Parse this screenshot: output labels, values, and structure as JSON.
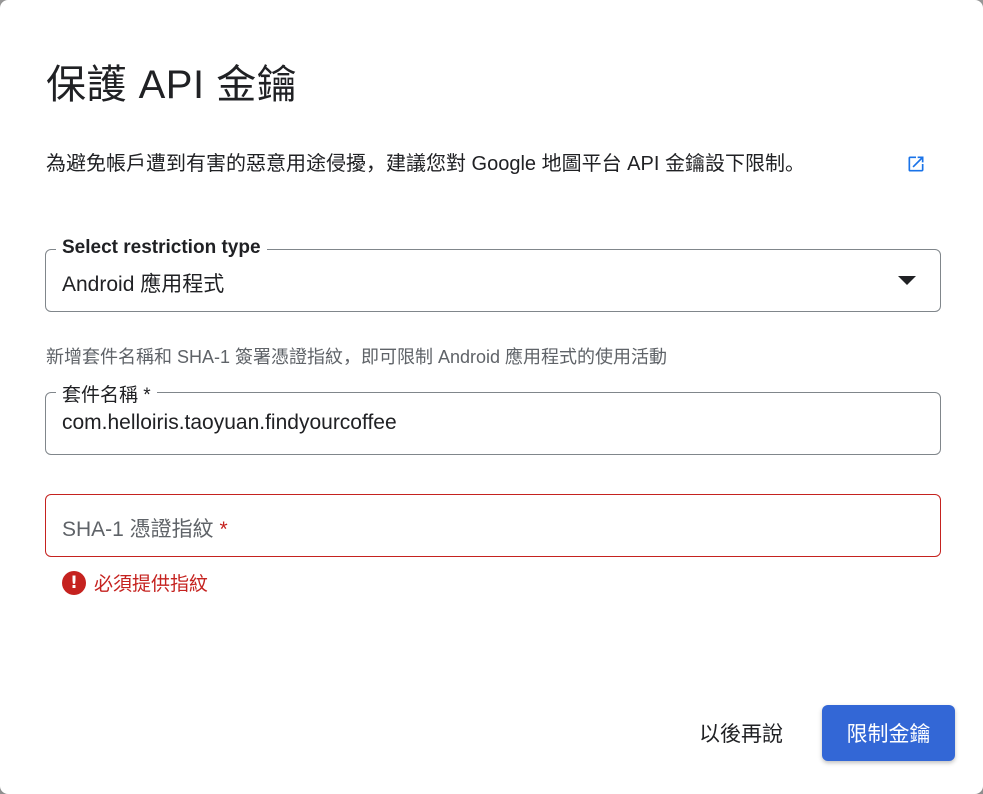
{
  "dialog": {
    "title": "保護 API 金鑰",
    "description": "為避免帳戶遭到有害的惡意用途侵擾，建議您對 Google 地圖平台 API 金鑰設下限制。",
    "link_icon": "external-link-icon"
  },
  "restriction_select": {
    "label": "Select restriction type",
    "value": "Android 應用程式"
  },
  "hint": "新增套件名稱和 SHA-1 簽署憑證指紋，即可限制 Android 應用程式的使用活動",
  "package_field": {
    "label": "套件名稱 *",
    "value": "com.helloiris.taoyuan.findyourcoffee"
  },
  "sha_field": {
    "placeholder": "SHA-1 憑證指紋",
    "required_mark": "*",
    "error_message": "必須提供指紋",
    "error_icon": "!"
  },
  "actions": {
    "later_label": "以後再說",
    "restrict_label": "限制金鑰"
  },
  "colors": {
    "primary": "#3367d6",
    "error": "#c5221f",
    "text": "#202124",
    "secondary_text": "#5f6368"
  }
}
